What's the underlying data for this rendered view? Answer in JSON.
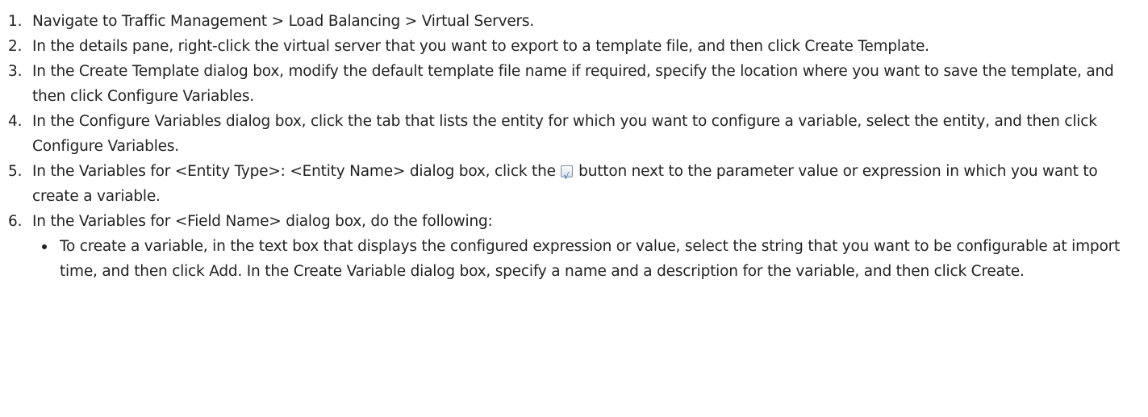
{
  "steps": [
    {
      "number": "1.",
      "text": "Navigate to Traffic Management > Load Balancing > Virtual Servers."
    },
    {
      "number": "2.",
      "text": "In the details pane, right-click the virtual server that you want to export to a template file, and then click Create Template."
    },
    {
      "number": "3.",
      "text": "In the Create Template dialog box, modify the default template file name if required, specify the location where you want to save the template, and then click Configure Variables."
    },
    {
      "number": "4.",
      "text": "In the Configure Variables dialog box, click the tab that lists the entity for which you want to configure a variable, select the entity, and then click Configure Variables."
    },
    {
      "number": "5.",
      "text_before": "In the Variables for <Entity Type>: <Entity Name> dialog box, click the",
      "icon": "formula-button-icon",
      "text_after": "button next to the parameter value or expression in which you want to create a variable."
    },
    {
      "number": "6.",
      "text": "In the Variables for <Field Name> dialog box, do the following:",
      "subitems": [
        {
          "text": "To create a variable, in the text box that displays the configured expression or value, select the string that you want to be configurable at import time, and then click Add. In the Create Variable dialog box, specify a name and a description for the variable, and then click Create."
        }
      ]
    }
  ]
}
